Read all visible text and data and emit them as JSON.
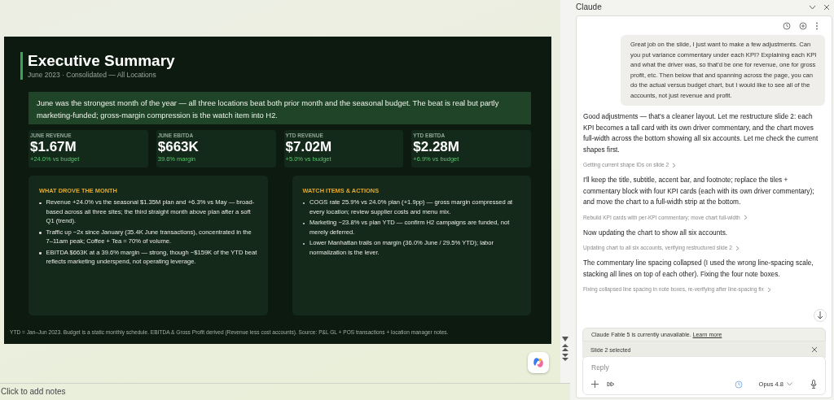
{
  "slide": {
    "title": "Executive Summary",
    "subtitle": "June 2023  ·  Consolidated — All Locations",
    "summary": "June was the strongest month of the year — all three locations beat both prior month and the seasonal budget. The beat is real but partly marketing-funded; gross-margin compression is the watch item into H2.",
    "kpis": [
      {
        "label": "JUNE REVENUE",
        "value": "$1.67M",
        "note": "+24.0% vs budget"
      },
      {
        "label": "JUNE EBITDA",
        "value": "$663K",
        "note": "39.6% margin"
      },
      {
        "label": "YTD REVENUE",
        "value": "$7.02M",
        "note": "+5.0% vs budget"
      },
      {
        "label": "YTD EBITDA",
        "value": "$2.28M",
        "note": "+6.9% vs budget"
      }
    ],
    "panels": [
      {
        "heading": "WHAT DROVE THE MONTH",
        "bullets": [
          "Revenue +24.0% vs the seasonal $1.35M plan and +6.3% vs May — broad-based across all three sites; the third straight month above plan after a soft Q1 (trend).",
          "Traffic up ~2x since January (35.4K June transactions), concentrated in the 7–11am peak; Coffee + Tea = 70% of volume.",
          "EBITDA $663K at a 39.6% margin — strong, though ~$159K of the YTD beat reflects marketing underspend, not operating leverage."
        ]
      },
      {
        "heading": "WATCH ITEMS & ACTIONS",
        "bullets": [
          "COGS rate 25.9% vs 24.0% plan (+1.9pp) — gross margin compressed at every location; review supplier costs and menu mix.",
          "Marketing −23.8% vs plan YTD — confirm H2 campaigns are funded, not merely deferred.",
          "Lower Manhattan trails on margin (36.0% June / 29.5% YTD); labor normalization is the lever."
        ]
      }
    ],
    "footnote": "YTD = Jan–Jun 2023. Budget is a static monthly schedule. EBITDA & Gross Profit derived (Revenue less cost accounts). Source: P&L GL + POS transactions + location manager notes."
  },
  "notes_placeholder": "Click to add notes",
  "panel": {
    "title": "Claude",
    "messages": [
      {
        "kind": "user",
        "text": "Great job on the slide, I just want to make a few adjustments. Can you put variance commentary under each KPI? Explaining each KPI and what the driver was, so that'd be one for revenue, one for gross profit, etc. Then below that and spanning across the page, you can do the actual versus budget chart, but I would like to see all of the accounts, not just revenue and profit."
      },
      {
        "kind": "assistant",
        "text": "Good adjustments — that's a cleaner layout. Let me restructure slide 2: each KPI becomes a tall card with its own driver commentary, and the chart moves full-width across the bottom showing all six accounts. Let me check the current shapes first."
      },
      {
        "kind": "step",
        "text": "Getting current shape IDs on slide 2"
      },
      {
        "kind": "assistant",
        "text": "I'll keep the title, subtitle, accent bar, and footnote; replace the tiles + commentary block with four KPI cards (each with its own driver commentary); and move the chart to a full-width strip at the bottom."
      },
      {
        "kind": "step",
        "text": "Rebuild KPI cards with per-KPI commentary; move chart full-width"
      },
      {
        "kind": "assistant",
        "text": "Now updating the chart to show all six accounts."
      },
      {
        "kind": "step",
        "text": "Updating chart to all six accounts, verifying restructured slide 2"
      },
      {
        "kind": "assistant",
        "text": "The commentary line spacing collapsed (I used the wrong line-spacing scale, stacking all lines on top of each other). Fixing the four note boxes."
      },
      {
        "kind": "step",
        "text": "Fixing collapsed line spacing in note boxes, re-verifying after line-spacing fix"
      }
    ],
    "notice": "Claude Fable 5 is currently unavailable.",
    "notice_link": "Learn more",
    "context": "Slide 2 selected",
    "reply_placeholder": "Reply",
    "model": "Opus 4.8"
  }
}
